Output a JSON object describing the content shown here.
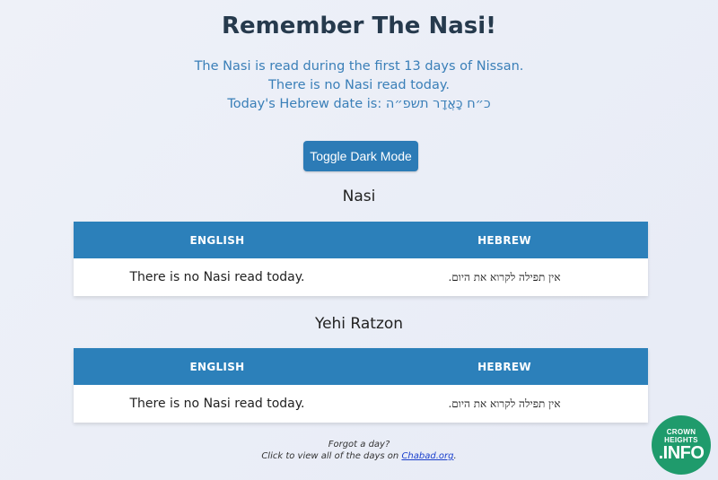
{
  "header": {
    "title": "Remember The Nasi!",
    "info_line1": "The Nasi is read during the first 13 days of Nissan.",
    "info_line2": "There is no Nasi read today.",
    "info_line3": "Today's Hebrew date is: כ״ח כָּאֲדָר תשפ״ה"
  },
  "toggle_label": "Toggle Dark Mode",
  "sections": [
    {
      "title": "Nasi",
      "col_english": "ENGLISH",
      "col_hebrew": "HEBREW",
      "english": "There is no Nasi read today.",
      "hebrew": "אין תפילה לקרוא את היום."
    },
    {
      "title": "Yehi Ratzon",
      "col_english": "ENGLISH",
      "col_hebrew": "HEBREW",
      "english": "There is no Nasi read today.",
      "hebrew": "אין תפילה לקרוא את היום."
    }
  ],
  "footer": {
    "line1": "Forgot a day?",
    "line2_prefix": "Click to view all of the days on ",
    "link_text": "Chabad.org",
    "line2_suffix": "."
  },
  "logo": {
    "line1": "CROWN",
    "line2": "HEIGHTS",
    "line3": ".INFO",
    "color": "#1f9b6c"
  }
}
